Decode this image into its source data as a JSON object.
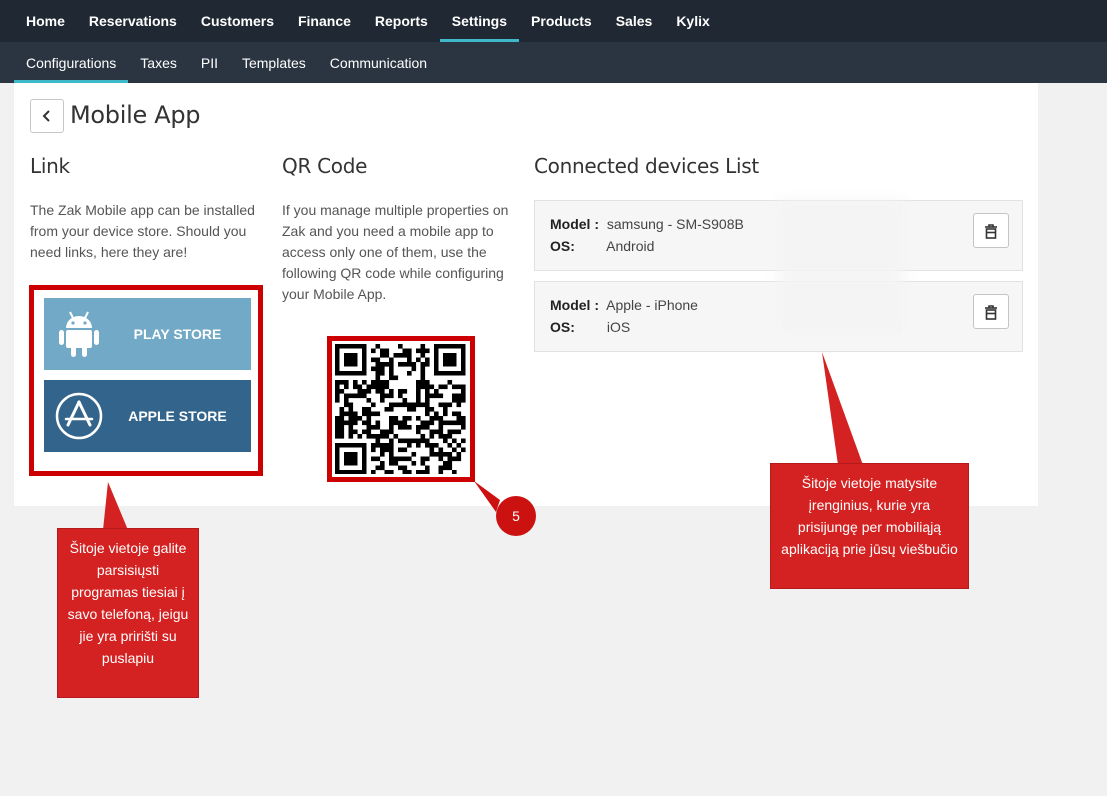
{
  "topnav": {
    "items": [
      "Home",
      "Reservations",
      "Customers",
      "Finance",
      "Reports",
      "Settings",
      "Products",
      "Sales",
      "Kylix"
    ],
    "active": "Settings"
  },
  "subnav": {
    "items": [
      "Configurations",
      "Taxes",
      "PII",
      "Templates",
      "Communication"
    ],
    "active": "Configurations"
  },
  "page": {
    "title": "Mobile App"
  },
  "link": {
    "title": "Link",
    "text": "The Zak Mobile app can be installed from your device store. Should you need links, here they are!",
    "play_store_label": "PLAY STORE",
    "apple_store_label": "APPLE STORE"
  },
  "qr": {
    "title": "QR Code",
    "text": "If you manage multiple properties on Zak and you need a mobile app to access only one of them, use the following QR code while configuring your Mobile App."
  },
  "devices": {
    "title": "Connected devices List",
    "model_label": "Model :",
    "os_label": "OS:",
    "items": [
      {
        "model": "samsung - SM-S908B",
        "os": "Android"
      },
      {
        "model": "Apple - iPhone",
        "os": "iOS"
      }
    ]
  },
  "annotations": {
    "left_callout": "Šitoje vietoje galite parsisiųsti programas tiesiai į savo telefoną, jeigu jie yra pririšti su puslapiu",
    "right_callout": "Šitoje vietoje matysite įrenginius, kurie yra prisijungę per mobiliąją aplikaciją prie jūsų viešbučio",
    "badge": "5"
  },
  "colors": {
    "nav_bg": "#1f2833",
    "subnav_bg": "#2b3541",
    "accent": "#3fb9c9",
    "play_store": "#71a9c7",
    "apple_store": "#33658c",
    "annotation_red": "#d42222"
  }
}
